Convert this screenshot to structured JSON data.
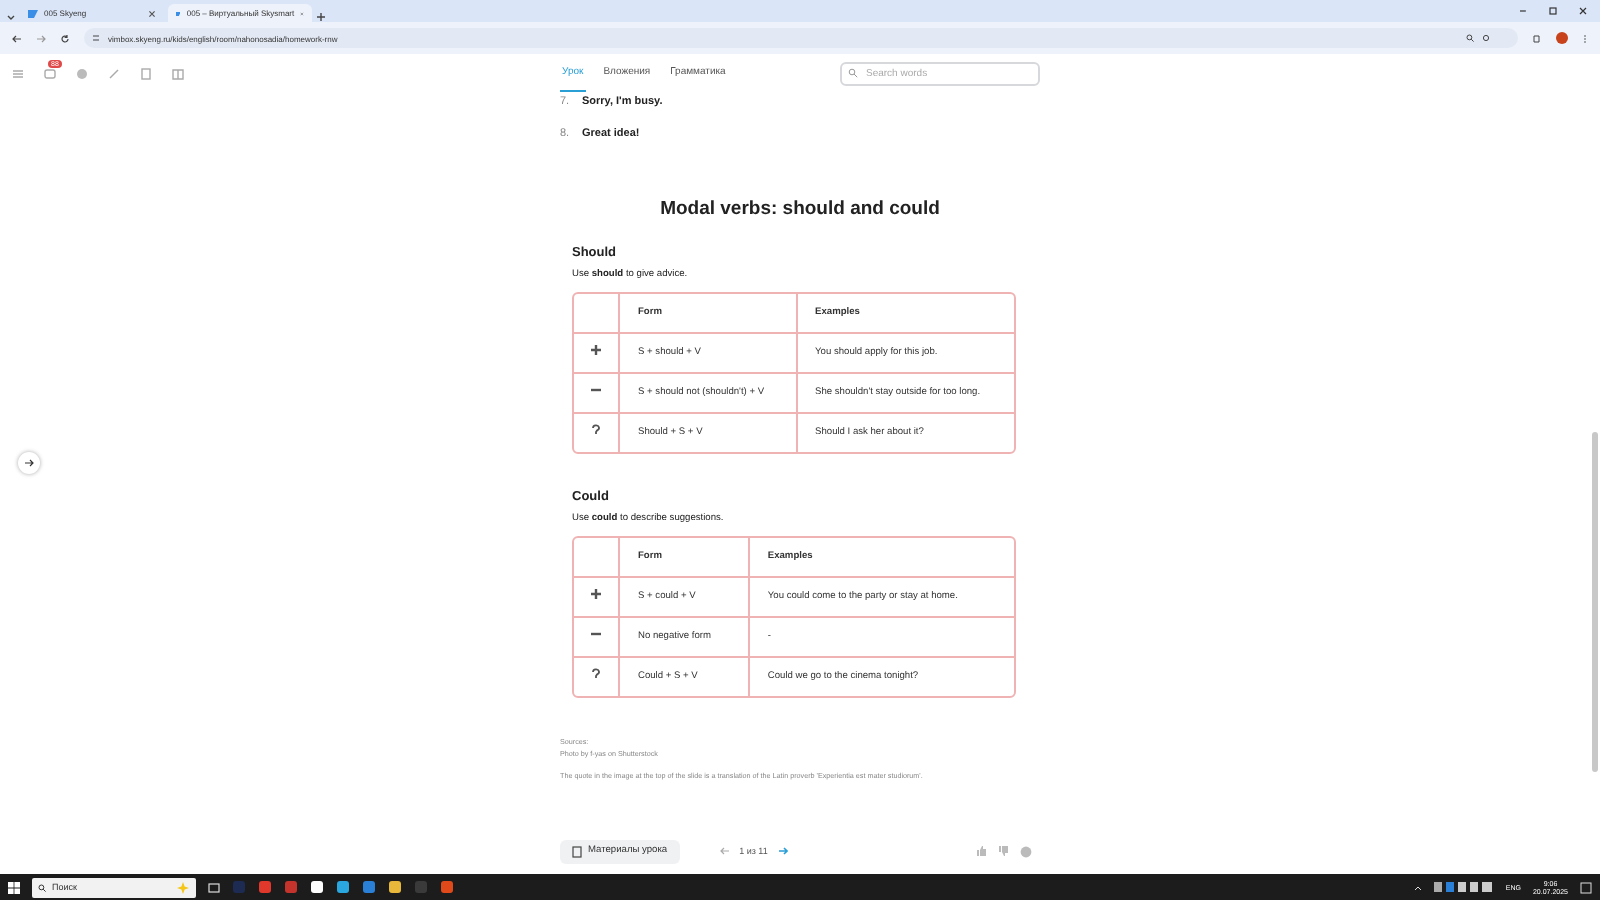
{
  "browser": {
    "tabs": [
      {
        "title": "005 Skyeng",
        "selected": false
      },
      {
        "title": "005 – Виртуальный Skysmart",
        "selected": true
      }
    ],
    "url": "vimbox.skyeng.ru/kids/english/room/nahonosadia/homework-rnw"
  },
  "app": {
    "badge": "88",
    "tabs": [
      {
        "label": "Урок",
        "selected": true
      },
      {
        "label": "Вложения",
        "selected": false
      },
      {
        "label": "Грамматика",
        "selected": false
      }
    ],
    "search": {
      "placeholder": "Search words"
    }
  },
  "content": {
    "numbered_items": [
      {
        "number": "7.",
        "text": "Sorry, I'm busy."
      },
      {
        "number": "8.",
        "text": "Great idea!"
      }
    ],
    "title": "Modal verbs: should and could",
    "sections": [
      {
        "heading": "Should",
        "intro": "Use **should** to give advice.",
        "columns": [
          "Form",
          "Examples"
        ],
        "rows": [
          {
            "kind": "positive",
            "form": "S + should + V",
            "example": "You should apply for this job."
          },
          {
            "kind": "negative",
            "form": "S + should not (shouldn't) + V",
            "example": "She shouldn't stay outside for too long."
          },
          {
            "kind": "question",
            "form": "Should + S + V",
            "example": "Should I ask her about it?"
          }
        ]
      },
      {
        "heading": "Could",
        "intro": "Use **could** to describe suggestions.",
        "columns": [
          "Form",
          "Examples"
        ],
        "rows": [
          {
            "kind": "positive",
            "form": "S + could + V",
            "example": "You could come to the party or stay at home."
          },
          {
            "kind": "negative",
            "form": "No negative form",
            "example": "-"
          },
          {
            "kind": "question",
            "form": "Could + S + V",
            "example": "Could we go to the cinema tonight?"
          }
        ]
      }
    ],
    "sources": [
      "Sources:",
      "Photo by f-yas on Shutterstock",
      "The quote in the image at the top of the slide is a translation of the Latin proverb 'Experientia est mater studiorum'."
    ]
  },
  "bottom_bar": {
    "materials_button": "Материалы урока",
    "pager": "1 из 11"
  },
  "taskbar": {
    "search_placeholder": "Поиск",
    "language": "ENG",
    "time": "9:06",
    "date": "20.07.2025"
  }
}
